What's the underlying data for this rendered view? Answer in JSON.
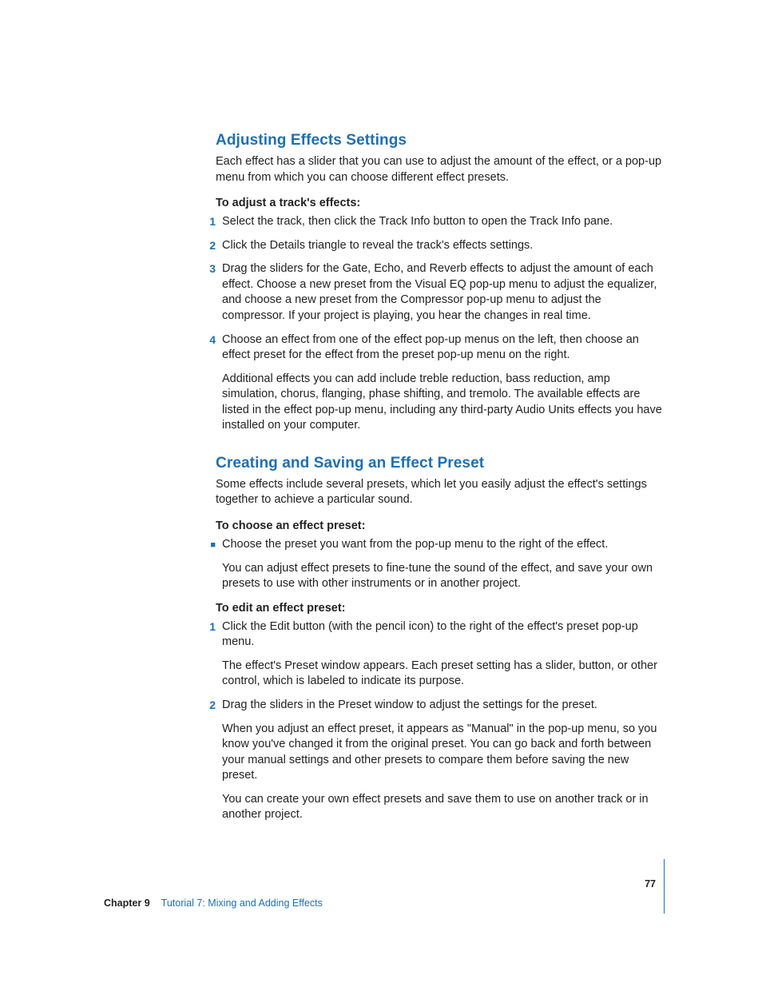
{
  "section1": {
    "heading": "Adjusting Effects Settings",
    "intro": "Each effect has a slider that you can use to adjust the amount of the effect, or a pop-up menu from which you can choose different effect presets.",
    "subhead": "To adjust a track's effects:",
    "steps": [
      "Select the track, then click the Track Info button to open the Track Info pane.",
      "Click the Details triangle to reveal the track's effects settings.",
      "Drag the sliders for the Gate, Echo, and Reverb effects to adjust the amount of each effect. Choose a new preset from the Visual EQ pop-up menu to adjust the equalizer, and choose a new preset from the Compressor pop-up menu to adjust the compressor. If your project is playing, you hear the changes in real time.",
      "Choose an effect from one of the effect pop-up menus on the left, then choose an effect preset for the effect from the preset pop-up menu on the right."
    ],
    "tail": "Additional effects you can add include treble reduction, bass reduction, amp simulation, chorus, flanging, phase shifting, and tremolo. The available effects are listed in the effect pop-up menu, including any third-party Audio Units effects you have installed on your computer."
  },
  "section2": {
    "heading": "Creating and Saving an Effect Preset",
    "intro": "Some effects include several presets, which let you easily adjust the effect's settings together to achieve a particular sound.",
    "chooseSubhead": "To choose an effect preset:",
    "chooseBullet": "Choose the preset you want from the pop-up menu to the right of the effect.",
    "chooseTail": "You can adjust effect presets to fine-tune the sound of the effect, and save your own presets to use with other instruments or in another project.",
    "editSubhead": "To edit an effect preset:",
    "editSteps": [
      {
        "main": "Click the Edit button (with the pencil icon) to the right of the effect's preset pop-up menu.",
        "after": "The effect's Preset window appears. Each preset setting has a slider, button, or other control, which is labeled to indicate its purpose."
      },
      {
        "main": "Drag the sliders in the Preset window to adjust the settings for the preset.",
        "after": "When you adjust an effect preset, it appears as \"Manual\" in the pop-up menu, so you know you've changed it from the original preset. You can go back and forth between your manual settings and other presets to compare them before saving the new preset.",
        "after2": "You can create your own effect presets and save them to use on another track or in another project."
      }
    ]
  },
  "footer": {
    "chapterLabel": "Chapter 9",
    "chapterTitle": "Tutorial 7:  Mixing and Adding Effects",
    "pageNumber": "77"
  },
  "markers": {
    "n1": "1",
    "n2": "2",
    "n3": "3",
    "n4": "4",
    "sq": "■"
  }
}
